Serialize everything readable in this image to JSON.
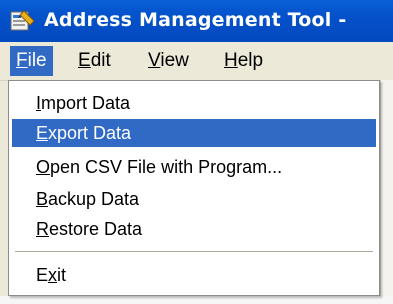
{
  "window": {
    "title": "Address Management Tool -",
    "icon": "address-book-app-icon"
  },
  "menubar": {
    "items": [
      {
        "label": "File",
        "underline": "F",
        "rest": "ile",
        "open": true
      },
      {
        "label": "Edit",
        "underline": "E",
        "rest": "dit",
        "open": false
      },
      {
        "label": "View",
        "underline": "V",
        "rest": "iew",
        "open": false
      },
      {
        "label": "Help",
        "underline": "H",
        "rest": "elp",
        "open": false
      }
    ]
  },
  "file_menu": {
    "items": [
      {
        "pre": "",
        "underline": "I",
        "rest": "mport Data",
        "label": "Import Data",
        "highlighted": false
      },
      {
        "pre": "",
        "underline": "E",
        "rest": "xport Data",
        "label": "Export Data",
        "highlighted": true
      },
      {
        "pre": "",
        "underline": "O",
        "rest": "pen CSV File with Program...",
        "label": "Open CSV File with Program...",
        "highlighted": false
      },
      {
        "pre": "",
        "underline": "B",
        "rest": "ackup Data",
        "label": "Backup Data",
        "highlighted": false
      },
      {
        "pre": "",
        "underline": "R",
        "rest": "estore Data",
        "label": "Restore Data",
        "highlighted": false
      },
      {
        "pre": "E",
        "underline": "x",
        "rest": "it",
        "label": "Exit",
        "highlighted": false
      }
    ]
  },
  "colors": {
    "titlebar": "#0451c9",
    "highlight": "#316ac5",
    "menubar": "#ece9d8"
  }
}
